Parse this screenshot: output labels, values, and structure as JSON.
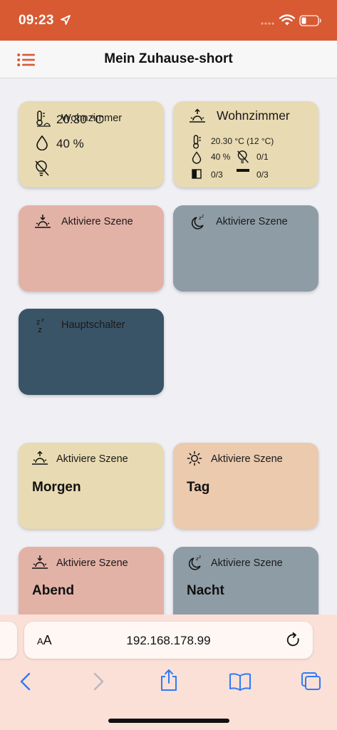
{
  "status": {
    "time": "09:23"
  },
  "nav": {
    "title": "Mein Zuhause-short"
  },
  "cards": {
    "room1": {
      "title": "Wohnzimmer",
      "temp": "20.30 °C",
      "humidity": "40 %"
    },
    "room2": {
      "title": "Wohnzimmer",
      "temp": "20.30 °C (12 °C)",
      "humidity": "40 %",
      "lights": "0/1",
      "windows": "0/3",
      "shutters": "0/3"
    },
    "scene1": {
      "label": "Aktiviere Szene"
    },
    "scene2": {
      "label": "Aktiviere Szene"
    },
    "master": {
      "label": "Hauptschalter"
    },
    "morgen": {
      "label": "Aktiviere Szene",
      "name": "Morgen"
    },
    "tag": {
      "label": "Aktiviere Szene",
      "name": "Tag"
    },
    "abend": {
      "label": "Aktiviere Szene",
      "name": "Abend"
    },
    "nacht": {
      "label": "Aktiviere Szene",
      "name": "Nacht"
    }
  },
  "browser": {
    "aa_small": "A",
    "aa_big": "A",
    "url": "192.168.178.99"
  },
  "colors": {
    "status_bar": "#d75a33",
    "card_yellow": "#e8dab2",
    "card_pink": "#e3b2a6",
    "card_grey": "#8e9ca5",
    "card_navy": "#3a5467",
    "card_peach": "#ebcaae",
    "ios_blue": "#2f7bf6"
  },
  "icons": [
    "location-arrow-icon",
    "wifi-icon",
    "battery-icon",
    "hamburger-menu-icon",
    "thermometer-sun-icon",
    "droplet-icon",
    "bulb-off-icon",
    "sunrise-icon",
    "window-icon",
    "shutter-icon",
    "sunset-icon",
    "moon-sleep-icon",
    "sleep-zzz-icon",
    "sun-icon",
    "reload-icon",
    "back-icon",
    "forward-icon",
    "share-icon",
    "bookmarks-icon",
    "tabs-icon"
  ]
}
